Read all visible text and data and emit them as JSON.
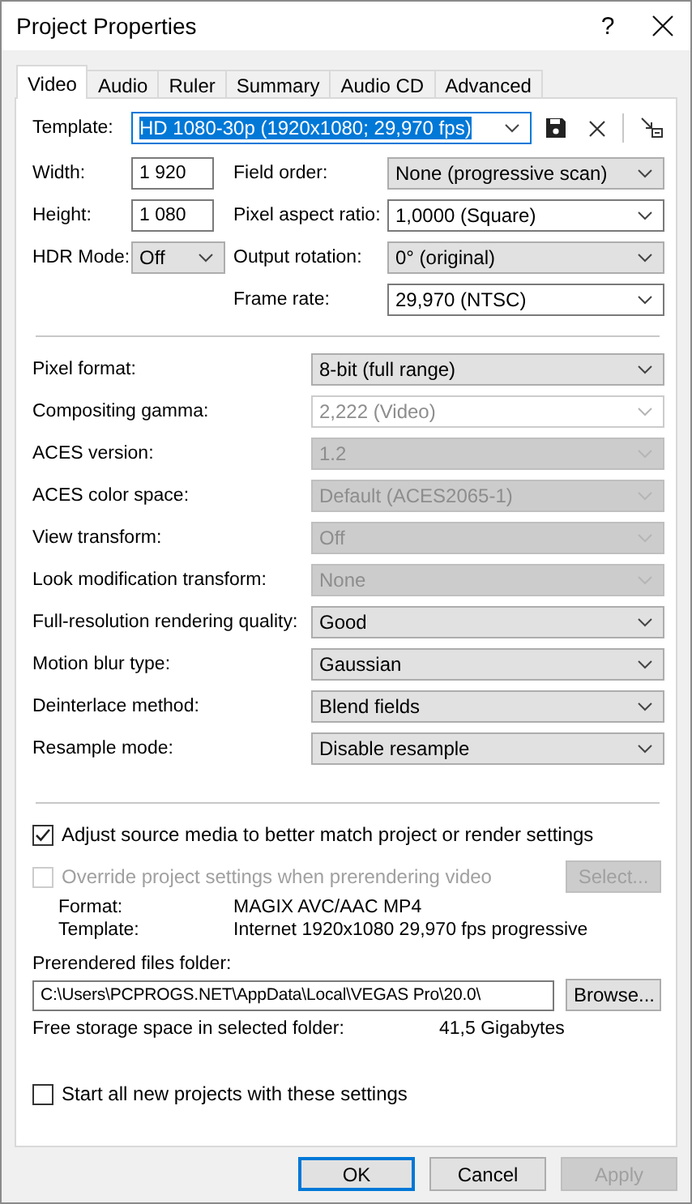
{
  "window": {
    "title": "Project Properties",
    "help": "?"
  },
  "tabs": [
    {
      "label": "Video",
      "selected": true
    },
    {
      "label": "Audio",
      "selected": false
    },
    {
      "label": "Ruler",
      "selected": false
    },
    {
      "label": "Summary",
      "selected": false
    },
    {
      "label": "Audio CD",
      "selected": false
    },
    {
      "label": "Advanced",
      "selected": false
    }
  ],
  "template": {
    "label": "Template:",
    "value": "HD 1080-30p (1920x1080; 29,970 fps)",
    "text_selected": true
  },
  "left_fields": [
    {
      "label": "Width:",
      "kind": "input",
      "value": "1 920"
    },
    {
      "label": "Height:",
      "kind": "input",
      "value": "1 080"
    },
    {
      "label": "HDR Mode:",
      "kind": "list",
      "value": "Off"
    }
  ],
  "right_fields": [
    {
      "label": "Field order:",
      "kind": "list",
      "value": "None (progressive scan)"
    },
    {
      "label": "Pixel aspect ratio:",
      "kind": "edit",
      "value": "1,0000 (Square)"
    },
    {
      "label": "Output rotation:",
      "kind": "list",
      "value": "0° (original)"
    },
    {
      "label": "Frame rate:",
      "kind": "edit",
      "value": "29,970 (NTSC)"
    }
  ],
  "settings": [
    {
      "label": "Pixel format:",
      "kind": "list",
      "value": "8-bit (full range)",
      "disabled": false
    },
    {
      "label": "Compositing gamma:",
      "kind": "edit",
      "value": "2,222 (Video)",
      "disabled": true
    },
    {
      "label": "ACES version:",
      "kind": "list",
      "value": "1.2",
      "disabled": true
    },
    {
      "label": "ACES color space:",
      "kind": "list",
      "value": "Default (ACES2065-1)",
      "disabled": true
    },
    {
      "label": "View transform:",
      "kind": "list",
      "value": "Off",
      "disabled": true
    },
    {
      "label": "Look modification transform:",
      "kind": "list",
      "value": "None",
      "disabled": true
    },
    {
      "label": "Full-resolution rendering quality:",
      "kind": "list",
      "value": "Good",
      "disabled": false
    },
    {
      "label": "Motion blur type:",
      "kind": "list",
      "value": "Gaussian",
      "disabled": false
    },
    {
      "label": "Deinterlace method:",
      "kind": "list",
      "value": "Blend fields",
      "disabled": false
    },
    {
      "label": "Resample mode:",
      "kind": "list",
      "value": "Disable resample",
      "disabled": false
    }
  ],
  "adjust_checkbox": {
    "label": "Adjust source media to better match project or render settings",
    "checked": true,
    "disabled": false
  },
  "override_checkbox": {
    "label": "Override project settings when prerendering video",
    "checked": false,
    "disabled": true
  },
  "select_button": {
    "label": "Select...",
    "disabled": true
  },
  "prerender_info": [
    {
      "label": "Format:",
      "value": "MAGIX AVC/AAC MP4"
    },
    {
      "label": "Template:",
      "value": "Internet 1920x1080 29,970 fps progressive"
    }
  ],
  "folder": {
    "label": "Prerendered files folder:",
    "value": "C:\\Users\\PCPROGS.NET\\AppData\\Local\\VEGAS Pro\\20.0\\",
    "browse": "Browse..."
  },
  "free_space": {
    "label": "Free storage space in selected folder:",
    "value": "41,5 Gigabytes"
  },
  "start_checkbox": {
    "label": "Start all new projects with these settings",
    "checked": false,
    "disabled": false
  },
  "buttons": [
    {
      "label": "OK",
      "default": true,
      "disabled": false
    },
    {
      "label": "Cancel",
      "default": false,
      "disabled": false
    },
    {
      "label": "Apply",
      "default": false,
      "disabled": true
    }
  ]
}
